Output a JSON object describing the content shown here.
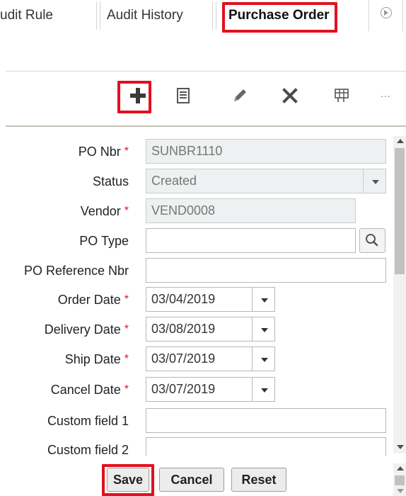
{
  "tabs": [
    {
      "label": "udit Rule"
    },
    {
      "label": "Audit History"
    },
    {
      "label": "Purchase Order",
      "active": true
    }
  ],
  "toolbar": {
    "items": [
      {
        "icon": "plus-icon",
        "label": "Add"
      },
      {
        "icon": "list-icon",
        "label": "Details"
      },
      {
        "icon": "pencil-icon",
        "label": "Edit"
      },
      {
        "icon": "close-icon",
        "label": "Delete"
      },
      {
        "icon": "table-icon",
        "label": "Grid"
      },
      {
        "icon": "more-icon",
        "label": "···"
      }
    ]
  },
  "form": {
    "po_nbr": {
      "label": "PO Nbr",
      "value": "SUNBR1110",
      "required": true
    },
    "status": {
      "label": "Status",
      "value": "Created"
    },
    "vendor": {
      "label": "Vendor",
      "value": "VEND0008",
      "required": true
    },
    "po_type": {
      "label": "PO Type",
      "value": ""
    },
    "po_ref": {
      "label": "PO Reference Nbr",
      "value": ""
    },
    "order_date": {
      "label": "Order Date",
      "value": "03/04/2019",
      "required": true
    },
    "delivery_date": {
      "label": "Delivery Date",
      "value": "03/08/2019",
      "required": true
    },
    "ship_date": {
      "label": "Ship Date",
      "value": "03/07/2019",
      "required": true
    },
    "cancel_date": {
      "label": "Cancel Date",
      "value": "03/07/2019",
      "required": true
    },
    "custom1": {
      "label": "Custom field 1",
      "value": ""
    },
    "custom2": {
      "label": "Custom field 2",
      "value": ""
    },
    "required_mark": "*"
  },
  "buttons": {
    "save": "Save",
    "cancel": "Cancel",
    "reset": "Reset"
  },
  "colors": {
    "highlight": "#e3101e",
    "readonly_bg": "#eef1f1"
  }
}
